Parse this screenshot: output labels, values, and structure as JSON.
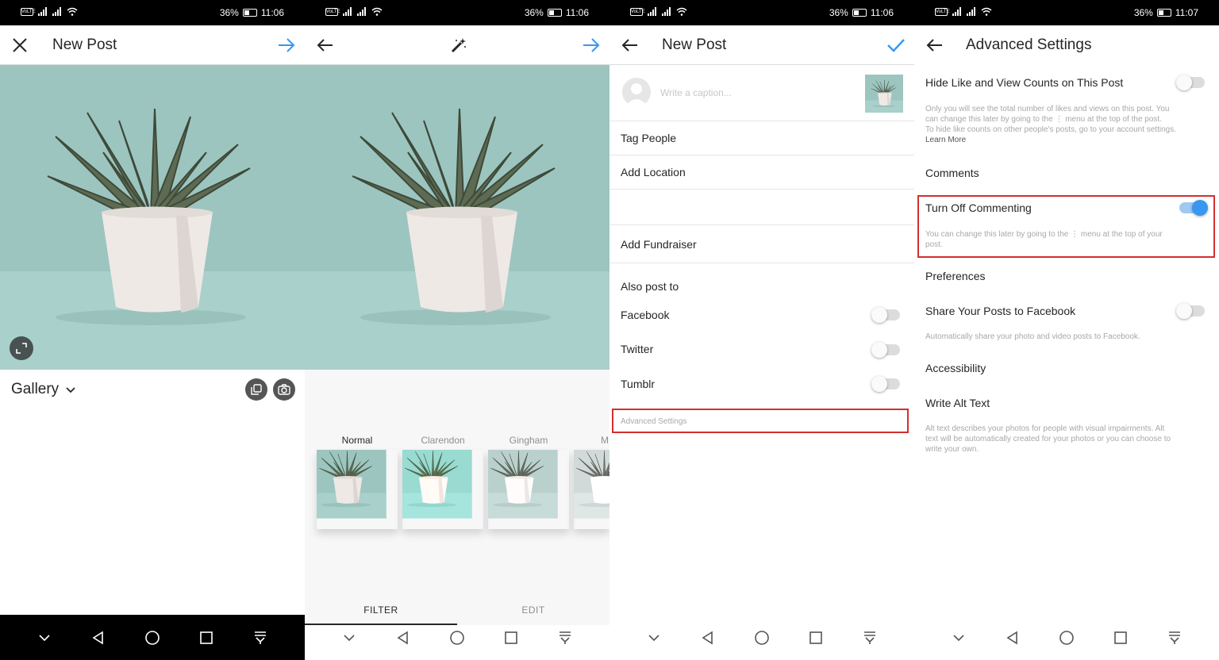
{
  "status_bars": [
    {
      "battery": "36%",
      "time": "11:06"
    },
    {
      "battery": "36%",
      "time": "11:06"
    },
    {
      "battery": "36%",
      "time": "11:06"
    },
    {
      "battery": "36%",
      "time": "11:07"
    }
  ],
  "screen1": {
    "title": "New Post",
    "gallery_label": "Gallery"
  },
  "screen2": {
    "filters": [
      "Normal",
      "Clarendon",
      "Gingham",
      "M"
    ],
    "tabs": [
      "FILTER",
      "EDIT"
    ]
  },
  "screen3": {
    "title": "New Post",
    "caption_placeholder": "Write a caption...",
    "rows": [
      "Tag People",
      "Add Location",
      "Add Fundraiser"
    ],
    "also_post_to": "Also post to",
    "share_targets": [
      {
        "label": "Facebook",
        "on": false
      },
      {
        "label": "Twitter",
        "on": false
      },
      {
        "label": "Tumblr",
        "on": false
      }
    ],
    "advanced_link": "Advanced Settings"
  },
  "screen4": {
    "title": "Advanced Settings",
    "hide_likes_label": "Hide Like and View Counts on This Post",
    "hide_likes_on": false,
    "hide_likes_desc_1": "Only you will see the total number of likes and views on this post. You",
    "hide_likes_desc_2": "can change this later by going to the ⋮ menu at the top of the post.",
    "hide_likes_desc_3": "To hide like counts on other people's posts, go to your account settings.",
    "learn_more": "Learn More",
    "comments_heading": "Comments",
    "turn_off_commenting_label": "Turn Off Commenting",
    "turn_off_commenting_on": true,
    "turn_off_desc_1": "You can change this later by going to the ⋮ menu at the top of your",
    "turn_off_desc_2": "post.",
    "preferences_heading": "Preferences",
    "share_fb_label": "Share Your Posts to Facebook",
    "share_fb_on": false,
    "share_fb_desc": "Automatically share your photo and video posts to Facebook.",
    "accessibility_heading": "Accessibility",
    "alt_text_label": "Write Alt Text",
    "alt_desc_1": "Alt text describes your photos for people with visual impairments. Alt",
    "alt_desc_2": "text will be automatically created for your photos or you can choose to",
    "alt_desc_3": "write your own."
  },
  "colors": {
    "accent": "#3897f0",
    "highlight_border": "#d32f2f",
    "photo_bg": "#9fc6c1"
  }
}
